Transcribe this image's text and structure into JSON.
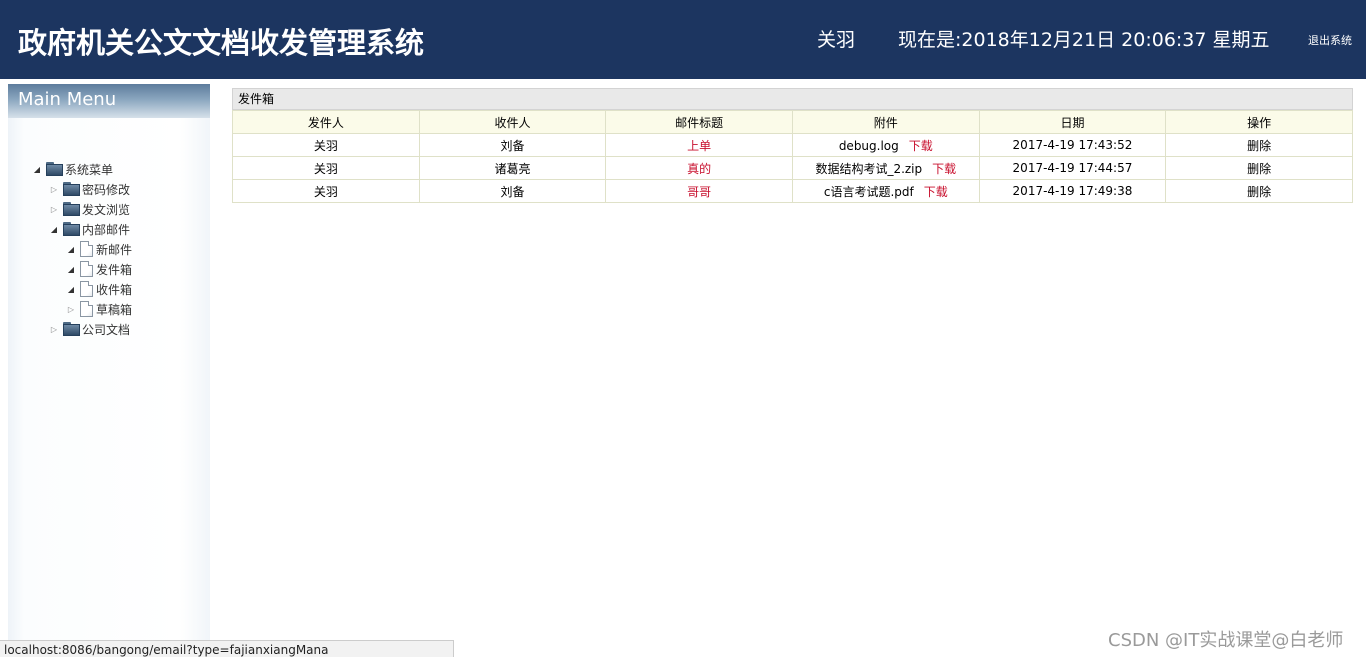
{
  "header": {
    "title": "政府机关公文文档收发管理系统",
    "user": "关羽",
    "clock": "现在是:2018年12月21日 20:06:37 星期五",
    "logout_label": "退出系统"
  },
  "sidebar": {
    "menu_title": "Main Menu",
    "tree": {
      "root": "系统菜单",
      "items": [
        {
          "label": "密码修改",
          "type": "folder",
          "expanded": false
        },
        {
          "label": "发文浏览",
          "type": "folder",
          "expanded": false
        },
        {
          "label": "内部邮件",
          "type": "folder",
          "expanded": true,
          "children": [
            {
              "label": "新邮件"
            },
            {
              "label": "发件箱"
            },
            {
              "label": "收件箱"
            },
            {
              "label": "草稿箱"
            }
          ]
        },
        {
          "label": "公司文档",
          "type": "folder",
          "expanded": false
        }
      ]
    }
  },
  "main": {
    "panel_title": "发件箱",
    "columns": [
      "发件人",
      "收件人",
      "邮件标题",
      "附件",
      "日期",
      "操作"
    ],
    "rows": [
      {
        "sender": "关羽",
        "recipient": "刘备",
        "subject": "上单",
        "attachment": "debug.log",
        "download": "下载",
        "date": "2017-4-19 17:43:52",
        "action": "删除"
      },
      {
        "sender": "关羽",
        "recipient": "诸葛亮",
        "subject": "真的",
        "attachment": "数据结构考试_2.zip",
        "download": "下载",
        "date": "2017-4-19 17:44:57",
        "action": "删除"
      },
      {
        "sender": "关羽",
        "recipient": "刘备",
        "subject": "哥哥",
        "attachment": "c语言考试题.pdf",
        "download": "下载",
        "date": "2017-4-19 17:49:38",
        "action": "删除"
      }
    ]
  },
  "statusbar": {
    "url": "localhost:8086/bangong/email?type=fajianxiangMana"
  },
  "watermark": "CSDN @IT实战课堂@白老师",
  "colors": {
    "header_bg": "#1c3560",
    "link_red": "#c8102e",
    "table_header_bg": "#fbfbe9"
  }
}
